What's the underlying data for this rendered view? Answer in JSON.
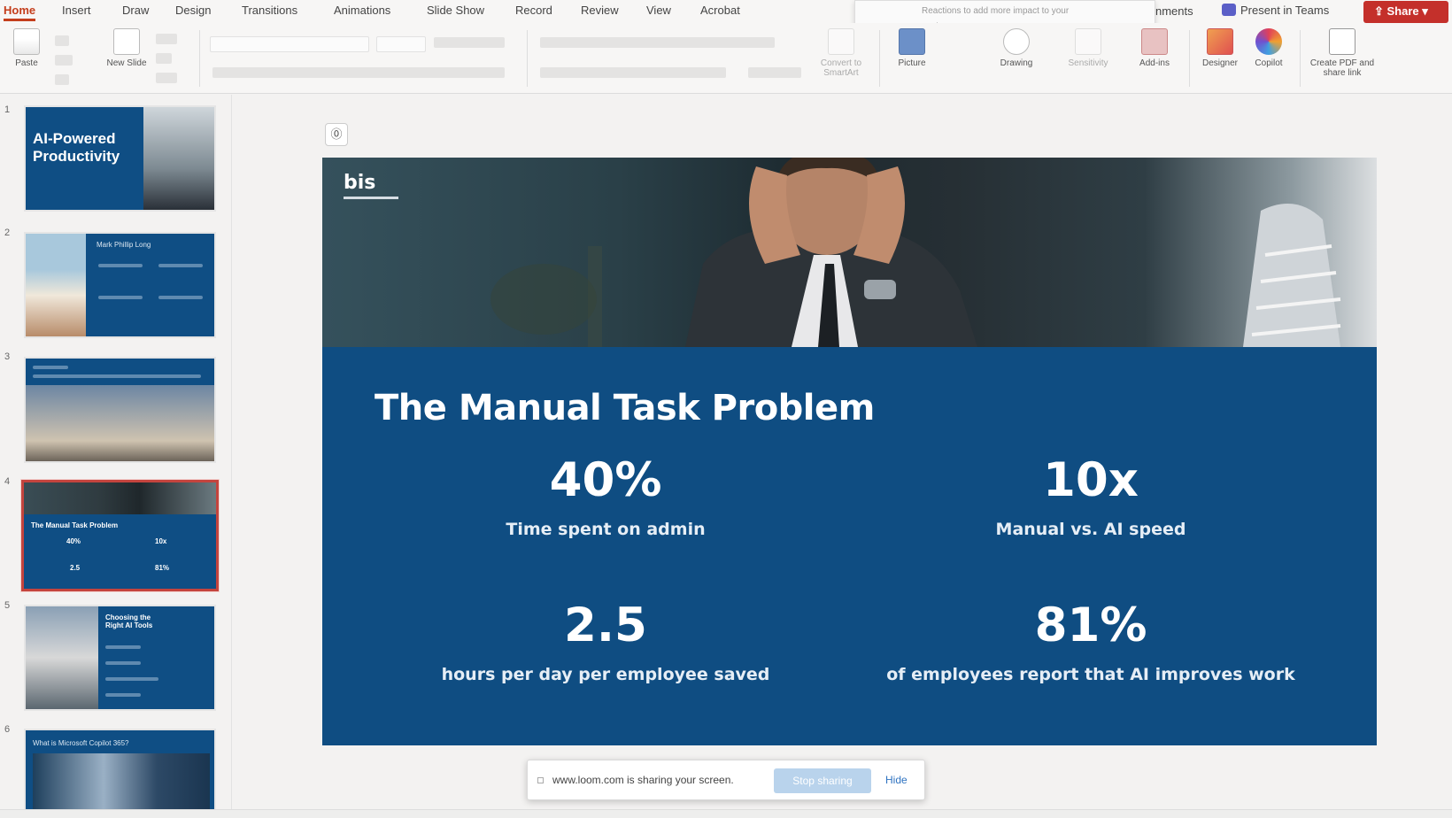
{
  "menu": {
    "tabs": [
      "Home",
      "Insert",
      "Draw",
      "Design",
      "Transitions",
      "Animations",
      "Slide Show",
      "Record",
      "Review",
      "View",
      "Acrobat"
    ],
    "active_tab": "Home",
    "comments_partial": "nments",
    "present_in_teams": "Present in Teams",
    "share": "Share",
    "popup_text": "Reactions to add more impact to your gestures"
  },
  "ribbon": {
    "paste": "Paste",
    "new_slide": "New Slide",
    "convert_smartart": "Convert to SmartArt",
    "picture": "Picture",
    "drawing": "Drawing",
    "sensitivity": "Sensitivity",
    "add_ins": "Add-ins",
    "designer": "Designer",
    "copilot": "Copilot",
    "create_pdf": "Create PDF and share link"
  },
  "thumbnails": {
    "numbers": [
      "1",
      "2",
      "3",
      "4",
      "5",
      "6"
    ],
    "slide1_title": "AI-Powered Productivity",
    "slide2_name": "Mark Phillip Long",
    "slide4_title": "The Manual Task Problem",
    "slide4_stats": [
      "40%",
      "10x",
      "2.5",
      "81%"
    ],
    "slide5_title": "Choosing the Right AI Tools",
    "slide6_title": "What is Microsoft Copilot 365?"
  },
  "slide": {
    "logo": "bis",
    "title": "The Manual Task Problem",
    "stats": [
      {
        "value": "40%",
        "label": "Time spent on admin"
      },
      {
        "value": "10x",
        "label": "Manual vs. AI speed"
      },
      {
        "value": "2.5",
        "label": "hours per day per employee saved"
      },
      {
        "value": "81%",
        "label": "of employees report that AI improves work"
      }
    ]
  },
  "share_bar": {
    "message": "www.loom.com is sharing your screen.",
    "stop": "Stop sharing",
    "hide": "Hide"
  },
  "colors": {
    "slide_bg": "#0f4d82",
    "accent": "#c43e1c",
    "share_button": "#c4302b"
  }
}
